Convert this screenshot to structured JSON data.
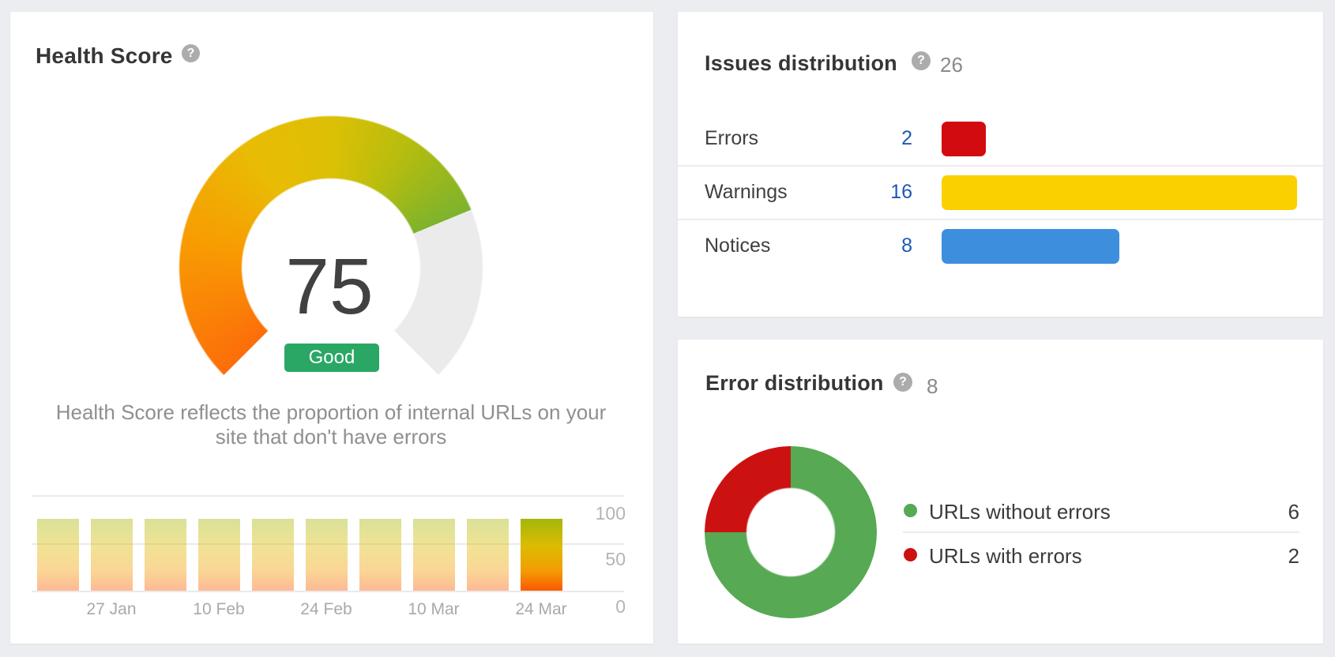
{
  "page": {
    "background": "#ebedf0"
  },
  "health_card": {
    "title": "Health Score",
    "help_icon": "question-mark",
    "score": "75",
    "score_label": "Good",
    "badge_color": "#2aa765",
    "description": "Health Score reflects the proportion of internal URLs on your site that don't have errors"
  },
  "issues_card": {
    "title": "Issues distribution",
    "help_icon": "question-mark",
    "total": "26",
    "rows": [
      {
        "label": "Errors",
        "count": "2",
        "color": "#d20b10"
      },
      {
        "label": "Warnings",
        "count": "16",
        "color": "#fad000"
      },
      {
        "label": "Notices",
        "count": "8",
        "color": "#3e8ede"
      }
    ],
    "count_link_color": "#1d59b3"
  },
  "error_card": {
    "title": "Error distribution",
    "help_icon": "question-mark",
    "total": "8",
    "legend": [
      {
        "label": "URLs without errors",
        "value": "6",
        "color": "#57a954"
      },
      {
        "label": "URLs with errors",
        "value": "2",
        "color": "#cc1211"
      }
    ]
  },
  "chart_data": [
    {
      "type": "gauge",
      "title": "Health Score",
      "value": 75,
      "max": 100,
      "sweep_degrees": 270,
      "label": "Good",
      "gradient": [
        "#fc6e0a",
        "#f89b02",
        "#e9bb04",
        "#dcc005",
        "#b7bd0e",
        "#7db32c"
      ],
      "rest_color": "#ebebeb"
    },
    {
      "type": "bar",
      "title": "Health Score trend",
      "categories": [
        "",
        "27 Jan",
        "",
        "10 Feb",
        "",
        "24 Feb",
        "",
        "10 Mar",
        "",
        "24 Mar"
      ],
      "values": [
        75,
        75,
        75,
        75,
        75,
        75,
        75,
        75,
        75,
        75
      ],
      "highlighted_index": 9,
      "ylim": [
        0,
        100
      ],
      "yticks": [
        100,
        50,
        0
      ],
      "ytick_labels": [
        "100",
        "50",
        "0"
      ],
      "grid": true
    },
    {
      "type": "bar",
      "orientation": "horizontal",
      "title": "Issues distribution",
      "total": 26,
      "categories": [
        "Errors",
        "Warnings",
        "Notices"
      ],
      "values": [
        2,
        16,
        8
      ],
      "colors": [
        "#d20b10",
        "#fad000",
        "#3e8ede"
      ]
    },
    {
      "type": "pie",
      "donut": true,
      "title": "Error distribution",
      "total": 8,
      "labels": [
        "URLs without errors",
        "URLs with errors"
      ],
      "values": [
        6,
        2
      ],
      "colors": [
        "#57a954",
        "#cc1211"
      ],
      "legend_position": "right"
    }
  ]
}
